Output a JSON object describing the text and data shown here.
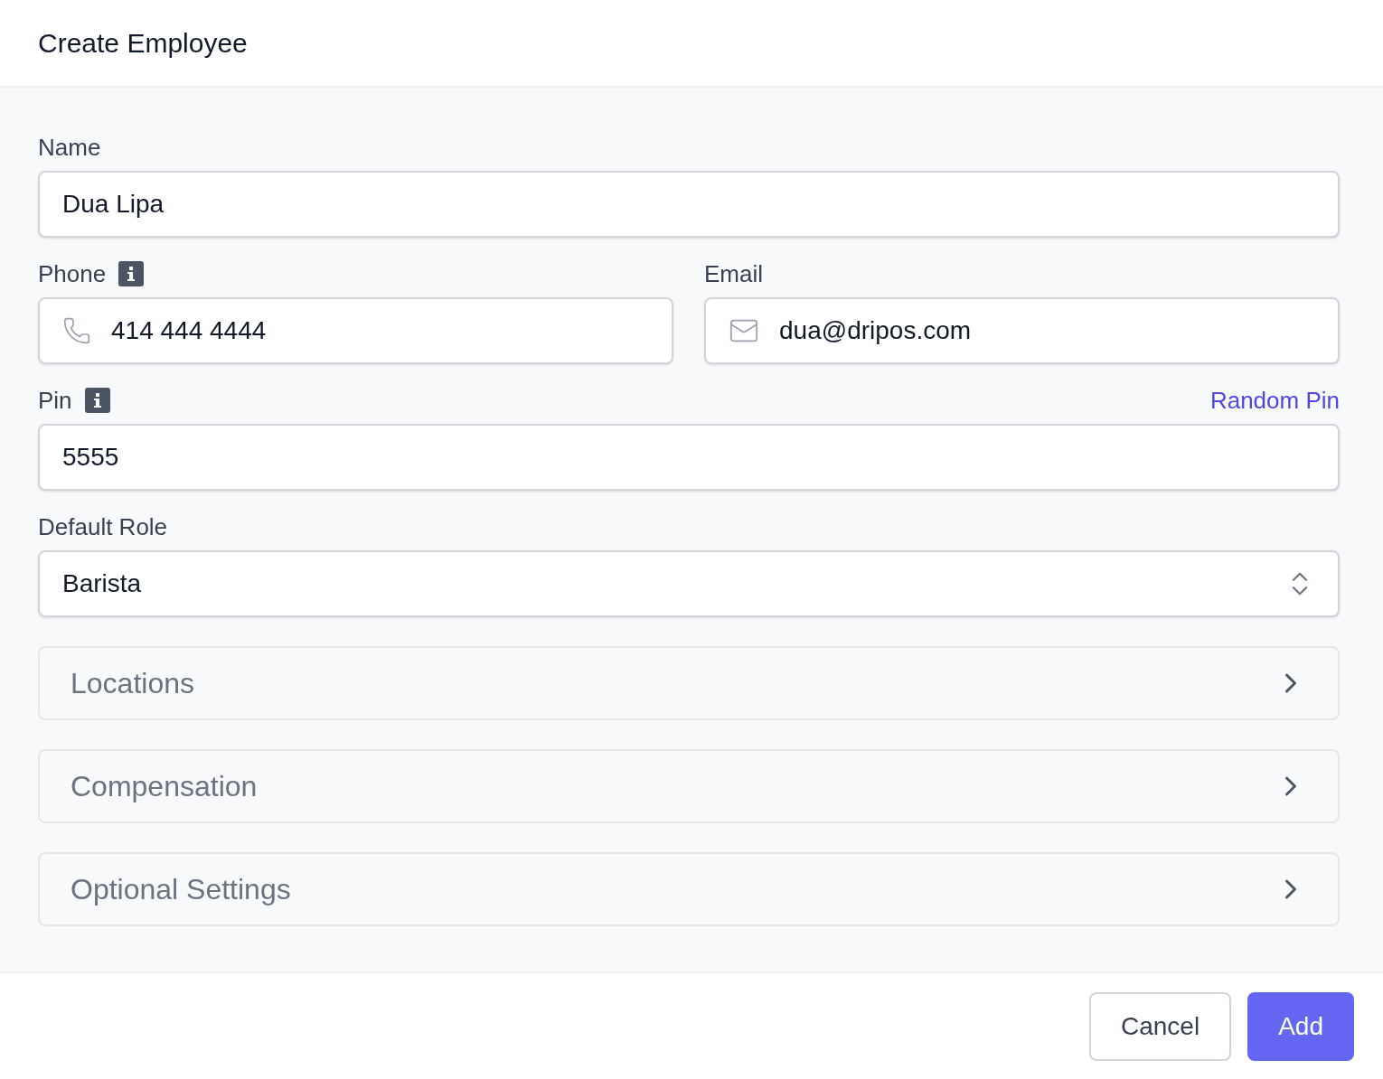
{
  "header": {
    "title": "Create Employee"
  },
  "fields": [
    {
      "kind": "text",
      "label": "Name",
      "info": false,
      "value": "Dua Lipa"
    },
    {
      "kind": "pair",
      "items": [
        {
          "kind": "phone",
          "label": "Phone",
          "info": true,
          "value": "414 444 4444"
        },
        {
          "kind": "email",
          "label": "Email",
          "info": false,
          "value": "dua@dripos.com"
        }
      ]
    },
    {
      "kind": "text",
      "label": "Pin",
      "info": true,
      "link": "Random Pin",
      "value": "5555"
    },
    {
      "kind": "select",
      "label": "Default Role",
      "info": false,
      "value": "Barista"
    }
  ],
  "sections": [
    {
      "title": "Locations",
      "expanded": false
    },
    {
      "title": "Compensation",
      "expanded": false
    },
    {
      "title": "Optional Settings",
      "expanded": false
    }
  ],
  "footer": {
    "buttons": [
      {
        "label": "Cancel",
        "kind": "secondary"
      },
      {
        "label": "Add",
        "kind": "primary"
      }
    ]
  }
}
